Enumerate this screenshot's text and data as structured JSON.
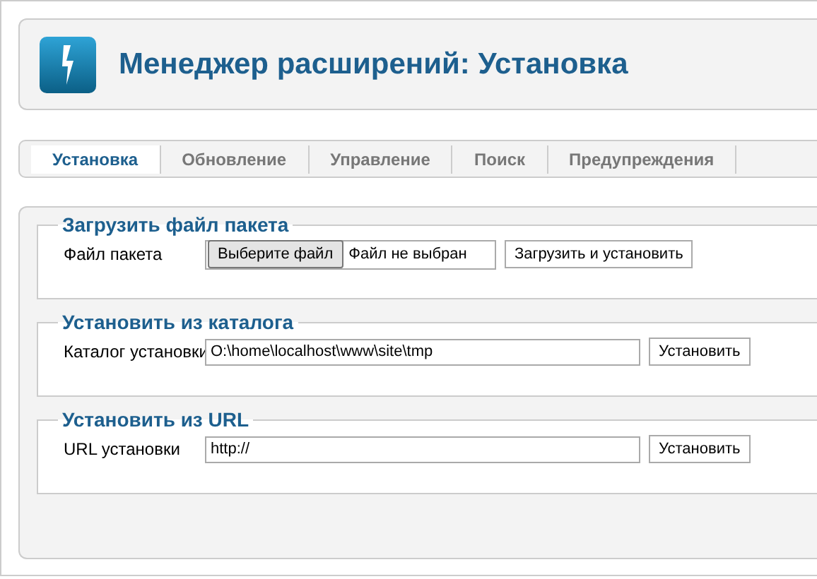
{
  "header": {
    "title": "Менеджер расширений: Установка"
  },
  "tabs": [
    {
      "label": "Установка",
      "selected": true
    },
    {
      "label": "Обновление",
      "selected": false
    },
    {
      "label": "Управление",
      "selected": false
    },
    {
      "label": "Поиск",
      "selected": false
    },
    {
      "label": "Предупреждения",
      "selected": false
    }
  ],
  "sections": [
    {
      "legend": "Загрузить файл пакета",
      "label": "Файл пакета",
      "kind": "file",
      "choose_button": "Выберите файл",
      "file_status": "Файл не выбран",
      "button": "Загрузить и установить"
    },
    {
      "legend": "Установить из каталога",
      "label": "Каталог установки",
      "kind": "text",
      "value": "O:\\home\\localhost\\www\\site\\tmp",
      "button": "Установить"
    },
    {
      "legend": "Установить из URL",
      "label": "URL установки",
      "kind": "text",
      "value": "http://",
      "button": "Установить"
    }
  ]
}
